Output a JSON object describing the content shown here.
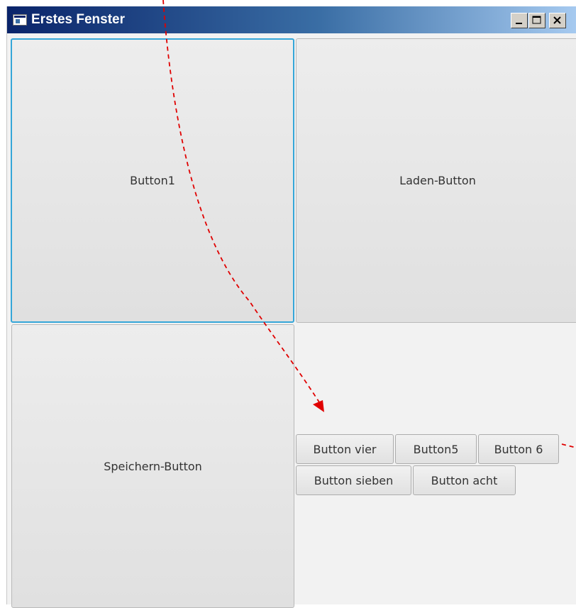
{
  "window": {
    "title": "Erstes Fenster",
    "controls": {
      "minimize": "minimize-icon",
      "maximize": "maximize-icon",
      "close": "close-icon"
    }
  },
  "buttons": {
    "button1": "Button1",
    "laden": "Laden-Button",
    "speichern": "Speichern-Button",
    "flow_row1": [
      "Button vier",
      "Button5",
      "Button 6"
    ],
    "flow_row2": [
      "Button sieben",
      "Button acht"
    ]
  },
  "colors": {
    "title_gradient_start": "#0a246a",
    "title_gradient_end": "#a6caf0",
    "focus_border": "#35a6d8",
    "annotation_arrow": "#e00000"
  }
}
